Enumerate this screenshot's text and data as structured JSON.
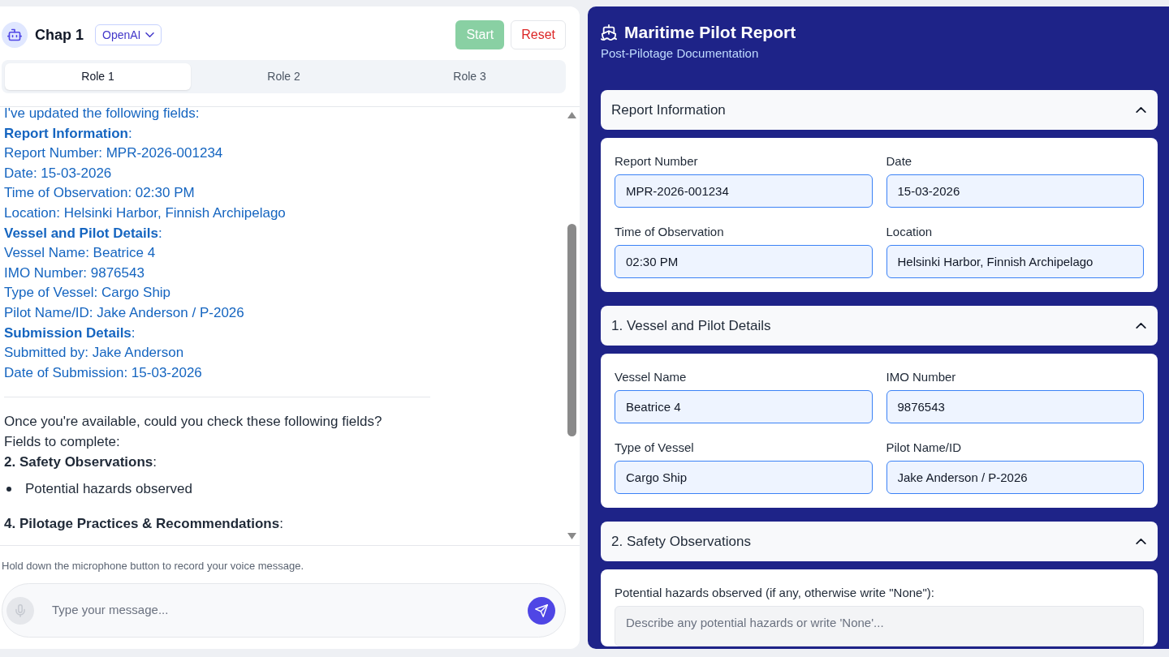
{
  "chat": {
    "title": "Chap 1",
    "model_select": {
      "label": "OpenAI"
    },
    "buttons": [
      {
        "label": "Start",
        "kind": "start",
        "disabled": true
      },
      {
        "label": "Reset",
        "kind": "reset",
        "disabled": false
      }
    ],
    "tabs": [
      {
        "label": "Role 1",
        "selected": true
      },
      {
        "label": "Role 2",
        "selected": false
      },
      {
        "label": "Role 3",
        "selected": false
      }
    ],
    "message": {
      "updated_lines": [
        "I've updated the following fields:",
        "**Report Information**:",
        "Report Number: MPR-2026-001234",
        "Date: 15-03-2026",
        "Time of Observation: 02:30 PM",
        "Location: Helsinki Harbor, Finnish Archipelago",
        "**Vessel and Pilot Details**:",
        "Vessel Name: Beatrice 4",
        "IMO Number: 9876543",
        "Type of Vessel: Cargo Ship",
        "Pilot Name/ID: Jake Anderson / P-2026",
        "**Submission Details**:",
        "Submitted by: Jake Anderson",
        "Date of Submission: 15-03-2026"
      ],
      "request_lines": [
        "Once you're available, could you check these following fields?",
        "Fields to complete:"
      ],
      "groups": [
        {
          "heading": "**2. Safety Observations**:",
          "items": [
            "Potential hazards observed"
          ]
        },
        {
          "heading": "**4. Pilotage Practices & Recommendations**:"
        }
      ]
    },
    "hint": "Hold down the microphone button to record your voice message.",
    "input": {
      "placeholder": "Type your message..."
    }
  },
  "report": {
    "title": "Maritime Pilot Report",
    "subtitle": "Post-Pilotage Documentation",
    "sections": [
      {
        "title": "Report Information",
        "expanded": true,
        "fields": [
          {
            "kind": "input",
            "label": "Report Number",
            "value": "MPR-2026-001234"
          },
          {
            "kind": "input",
            "label": "Date",
            "value": "15-03-2026"
          },
          {
            "kind": "input",
            "label": "Time of Observation",
            "value": "02:30 PM"
          },
          {
            "kind": "input",
            "label": "Location",
            "value": "Helsinki Harbor, Finnish Archipelago"
          }
        ]
      },
      {
        "title": "1. Vessel and Pilot Details",
        "expanded": true,
        "fields": [
          {
            "kind": "input",
            "label": "Vessel Name",
            "value": "Beatrice 4"
          },
          {
            "kind": "input",
            "label": "IMO Number",
            "value": "9876543"
          },
          {
            "kind": "input",
            "label": "Type of Vessel",
            "value": "Cargo Ship"
          },
          {
            "kind": "input",
            "label": "Pilot Name/ID",
            "value": "Jake Anderson / P-2026"
          }
        ]
      },
      {
        "title": "2. Safety Observations",
        "expanded": true,
        "fields": [
          {
            "kind": "textarea",
            "label": "Potential hazards observed (if any, otherwise write \"None\"):",
            "placeholder": "Describe any potential hazards or write 'None'..."
          }
        ]
      }
    ]
  }
}
